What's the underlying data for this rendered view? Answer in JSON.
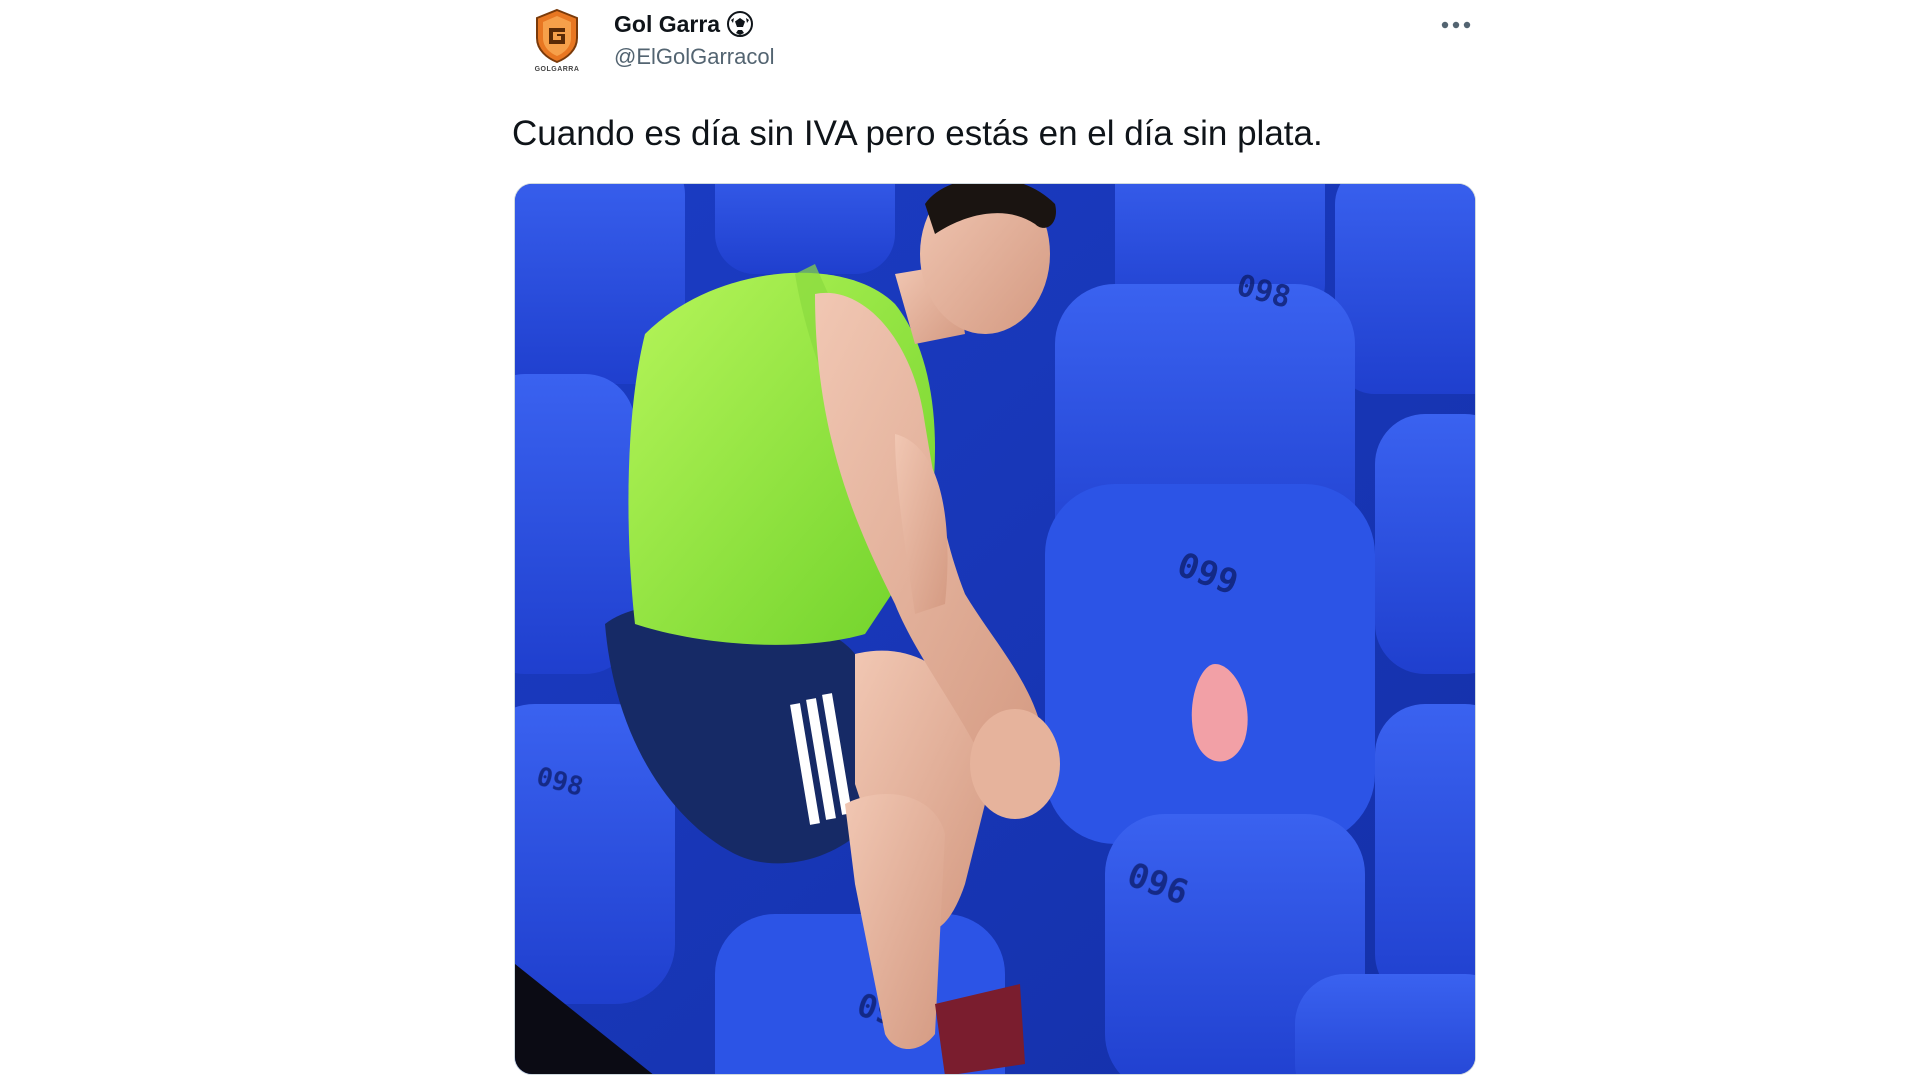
{
  "author": {
    "display_name": "Gol Garra",
    "handle": "@ElGolGarracol",
    "avatar_icon": "shield-logo-icon",
    "avatar_caption": "GOLGARRA",
    "badge_icon": "soccer-ball-icon"
  },
  "tweet": {
    "text": "Cuando es día sin IVA pero estás en el día sin plata."
  },
  "menu": {
    "more_icon": "more-dots-icon"
  },
  "media": {
    "seat_numbers": [
      "098",
      "099",
      "096",
      "097",
      "098"
    ]
  },
  "colors": {
    "text_primary": "#0f1419",
    "text_secondary": "#536471",
    "seat_blue": "#2448d8",
    "bib_green": "#8fe43a",
    "avatar_orange": "#e87722"
  }
}
